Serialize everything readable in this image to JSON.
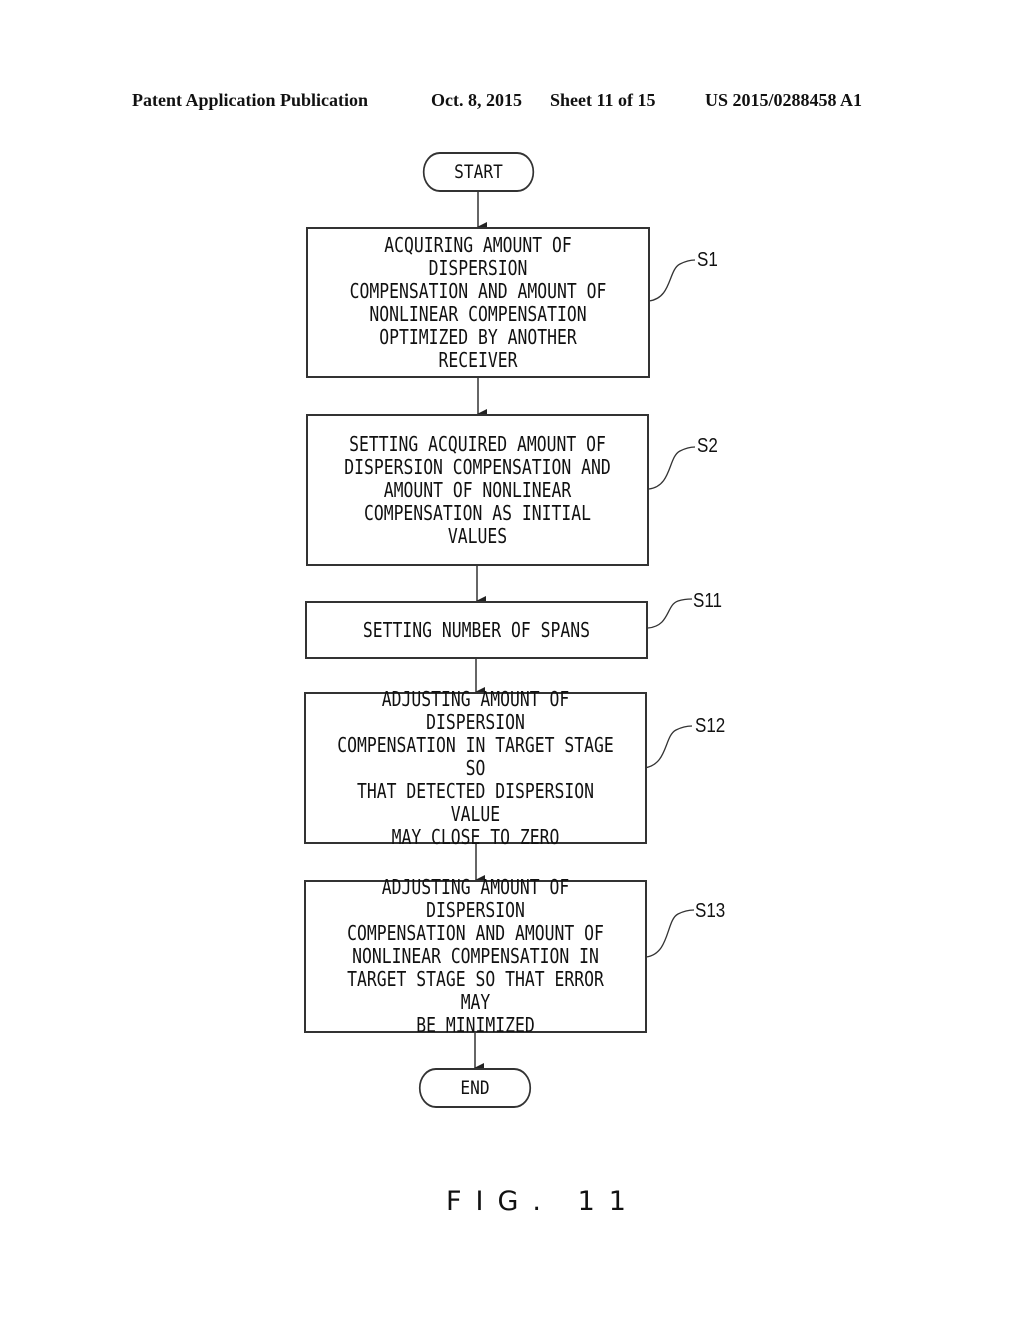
{
  "header": {
    "publication_type": "Patent Application Publication",
    "date": "Oct. 8, 2015",
    "sheet": "Sheet 11 of 15",
    "patent_number": "US 2015/0288458 A1"
  },
  "flowchart": {
    "start_label": "START",
    "end_label": "END",
    "steps": [
      {
        "id": "S1",
        "text": "ACQUIRING AMOUNT OF DISPERSION\nCOMPENSATION AND AMOUNT OF\nNONLINEAR COMPENSATION\nOPTIMIZED BY ANOTHER RECEIVER"
      },
      {
        "id": "S2",
        "text": "SETTING ACQUIRED AMOUNT OF\nDISPERSION COMPENSATION AND\nAMOUNT OF NONLINEAR\nCOMPENSATION AS INITIAL VALUES"
      },
      {
        "id": "S11",
        "text": "SETTING NUMBER OF SPANS"
      },
      {
        "id": "S12",
        "text": "ADJUSTING AMOUNT OF DISPERSION\nCOMPENSATION IN TARGET STAGE SO\nTHAT DETECTED DISPERSION VALUE\nMAY CLOSE TO ZERO"
      },
      {
        "id": "S13",
        "text": "ADJUSTING AMOUNT OF DISPERSION\nCOMPENSATION AND AMOUNT OF\nNONLINEAR COMPENSATION IN\nTARGET STAGE SO THAT ERROR MAY\nBE MINIMIZED"
      }
    ]
  },
  "figure_caption": "FIG. 11"
}
